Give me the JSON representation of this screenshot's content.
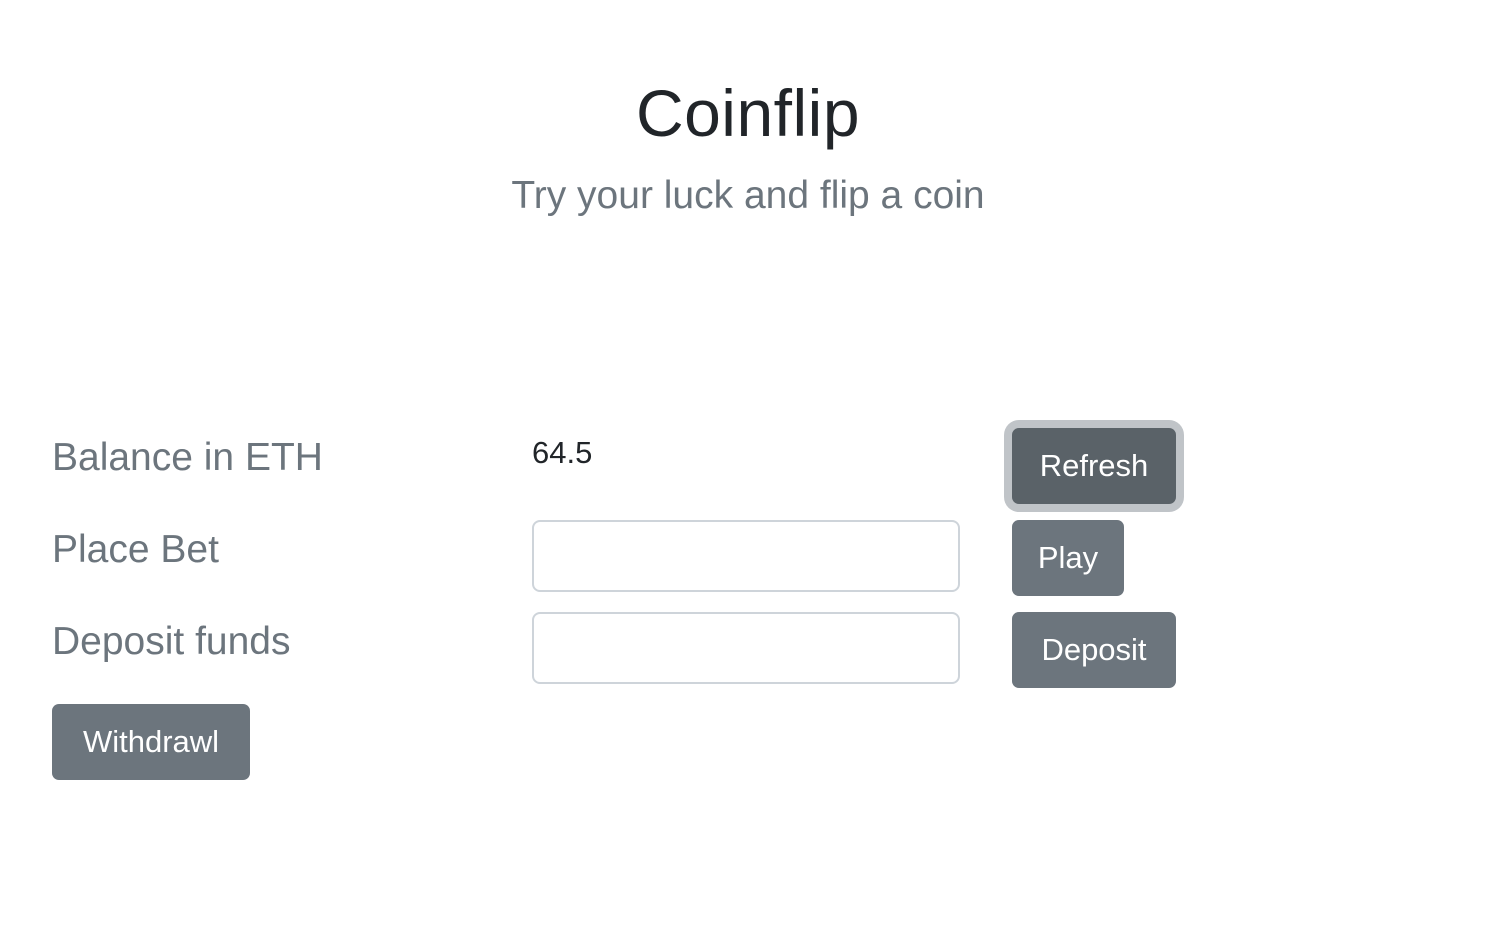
{
  "header": {
    "title": "Coinflip",
    "subtitle": "Try your luck and flip a coin"
  },
  "balance": {
    "label": "Balance in ETH",
    "value": "64.5",
    "refresh_label": "Refresh"
  },
  "bet": {
    "label": "Place Bet",
    "input_value": "",
    "play_label": "Play"
  },
  "deposit": {
    "label": "Deposit funds",
    "input_value": "",
    "deposit_label": "Deposit"
  },
  "withdraw": {
    "label": "Withdrawl"
  },
  "colors": {
    "button_bg": "#6c757d",
    "button_focused_bg": "#5a6268",
    "muted_text": "#6c757d",
    "body_text": "#212529"
  }
}
